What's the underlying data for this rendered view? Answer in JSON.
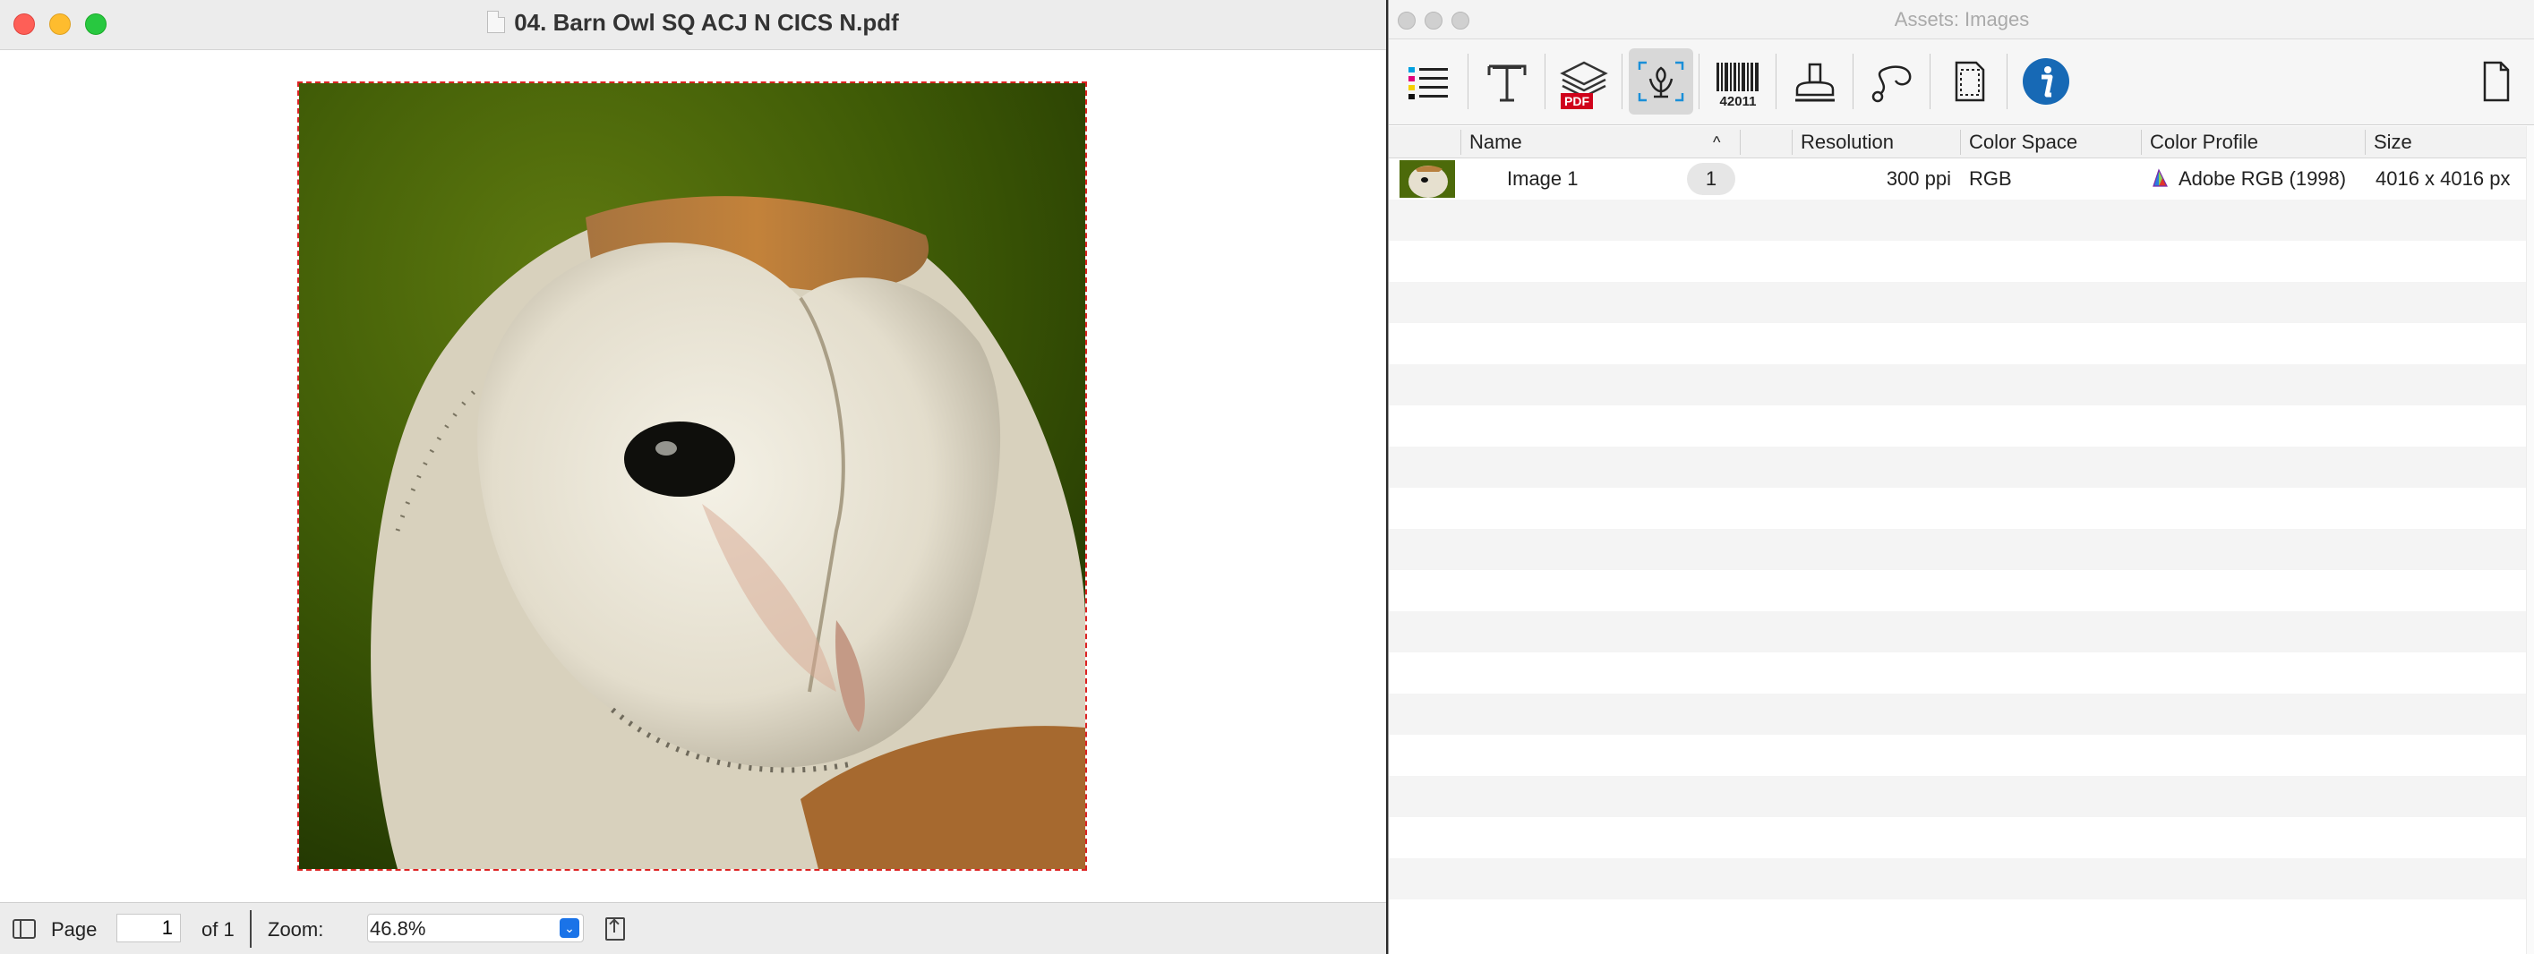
{
  "document_window": {
    "title": "04. Barn Owl SQ ACJ N CICS N.pdf",
    "statusbar": {
      "page_label": "Page",
      "page_value": "1",
      "of_label": "of 1",
      "zoom_label": "Zoom:",
      "zoom_value": "46.8%"
    }
  },
  "assets_panel": {
    "title": "Assets: Images",
    "toolbar": {
      "items": [
        {
          "name": "separations",
          "icon": "color-list-icon"
        },
        {
          "name": "fonts",
          "icon": "type-t-icon"
        },
        {
          "name": "pdf-layers",
          "icon": "pdf-layers-icon",
          "badge": "PDF"
        },
        {
          "name": "images",
          "icon": "image-flower-icon",
          "active": true
        },
        {
          "name": "barcodes",
          "icon": "barcode-icon",
          "badge": "42011"
        },
        {
          "name": "stamps",
          "icon": "stamp-icon"
        },
        {
          "name": "paths",
          "icon": "path-curve-icon"
        },
        {
          "name": "page-boxes",
          "icon": "page-box-icon"
        },
        {
          "name": "info",
          "icon": "info-icon"
        },
        {
          "name": "document",
          "icon": "document-icon"
        }
      ]
    },
    "table": {
      "columns": [
        "Name",
        "Resolution",
        "Color Space",
        "Color Profile",
        "Size"
      ],
      "sort_indicator": "^",
      "rows": [
        {
          "name": "Image 1",
          "count": "1",
          "resolution": "300 ppi",
          "color_space": "RGB",
          "color_profile": "Adobe RGB (1998)",
          "size": "4016 x 4016 px"
        }
      ]
    }
  },
  "colors": {
    "accent_blue": "#1a73e8",
    "info_blue": "#1769b5",
    "pdf_red": "#d0021b",
    "crop_border": "#dd2222"
  }
}
